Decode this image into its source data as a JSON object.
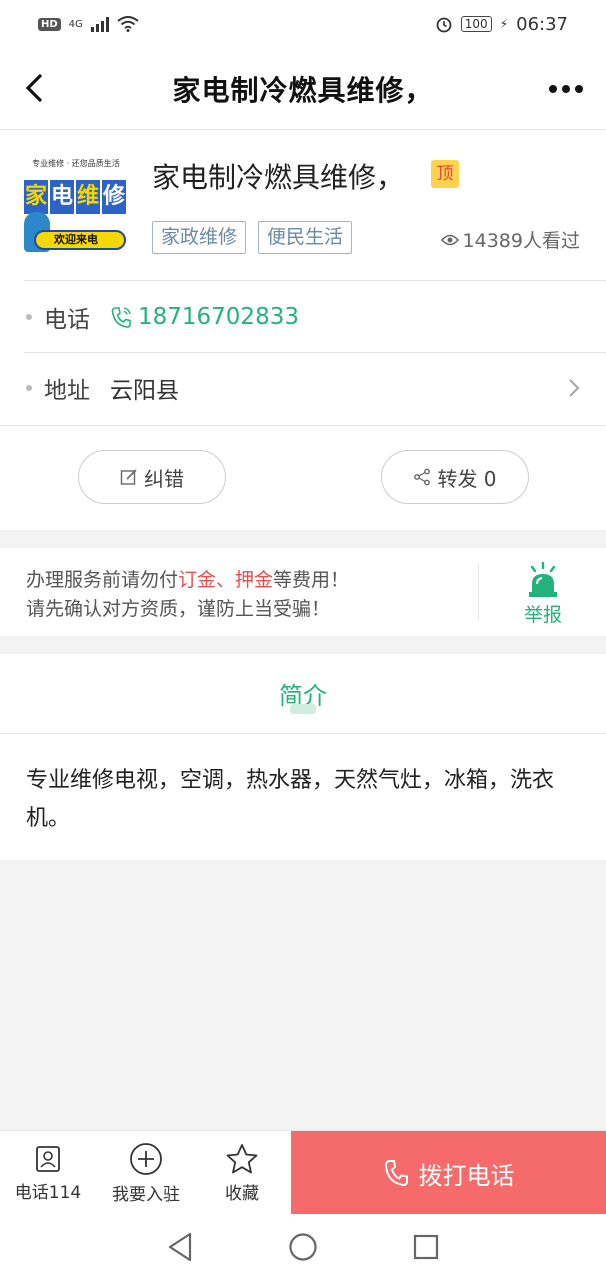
{
  "status_bar": {
    "network": "4G",
    "hd": "HD",
    "battery": "100",
    "time": "06:37"
  },
  "nav": {
    "title": "家电制冷燃具维修，"
  },
  "listing": {
    "thumb_caption": "专业维修 · 还您品质生活",
    "thumb_big": [
      "家",
      "电",
      "维",
      "修"
    ],
    "thumb_banner": "欢迎来电",
    "title": "家电制冷燃具维修，",
    "top_badge": "顶",
    "tags": [
      "家政维修",
      "便民生活"
    ],
    "views": "14389人看过"
  },
  "contact": {
    "phone_label": "电话",
    "phone_value": "18716702833",
    "address_label": "地址",
    "address_value": "云阳县"
  },
  "actions": {
    "correct_label": "纠错",
    "share_label": "转发 0"
  },
  "warning": {
    "line1_prefix": "办理服务前请勿付",
    "line1_red": "订金、押金",
    "line1_suffix": "等费用！",
    "line2": "请先确认对方资质，谨防上当受骗！",
    "report_label": "举报"
  },
  "intro": {
    "heading": "简介",
    "body": "专业维修电视，空调，热水器，天然气灶，冰箱，洗衣机。"
  },
  "tabbar": {
    "items": [
      {
        "label": "电话114",
        "icon": "contact-card-icon"
      },
      {
        "label": "我要入驻",
        "icon": "plus-circle-icon"
      },
      {
        "label": "收藏",
        "icon": "star-icon"
      }
    ],
    "call_label": "拨打电话"
  },
  "colors": {
    "accent_green": "#23b37a",
    "call_red": "#f56b6b",
    "warn_red": "#e45050"
  }
}
